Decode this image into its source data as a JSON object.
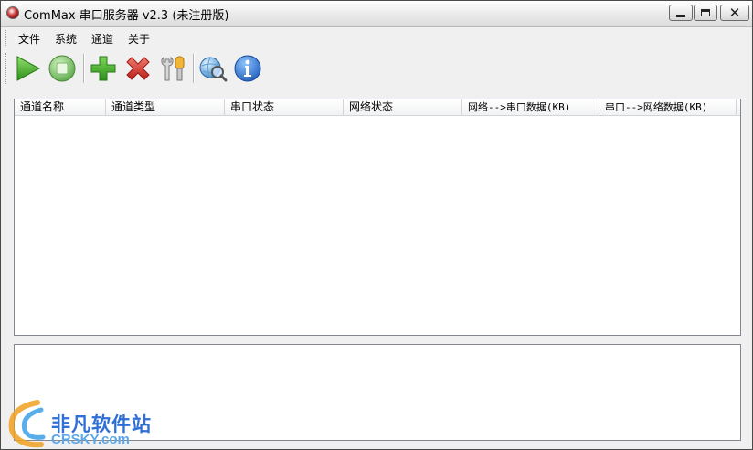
{
  "window": {
    "title": "ComMax 串口服务器 v2.3 (未注册版)"
  },
  "menu": [
    "文件",
    "系统",
    "通道",
    "关于"
  ],
  "toolbar": [
    {
      "icon": "play-icon"
    },
    {
      "icon": "stop-icon"
    },
    {
      "icon": "add-icon"
    },
    {
      "icon": "delete-icon"
    },
    {
      "icon": "settings-tools-icon"
    },
    {
      "icon": "network-search-icon"
    },
    {
      "icon": "info-icon"
    }
  ],
  "channel_table": {
    "columns": [
      "通道名称",
      "通道类型",
      "串口状态",
      "网络状态",
      "网络-->串口数据(KB)",
      "串口-->网络数据(KB)"
    ],
    "rows": []
  },
  "watermark": {
    "cn": "非凡软件站",
    "en": "CRSKY.com"
  },
  "colors": {
    "play": "#4caf2a",
    "add": "#3cab2a",
    "delete": "#d9342b",
    "info": "#1f66c9"
  }
}
